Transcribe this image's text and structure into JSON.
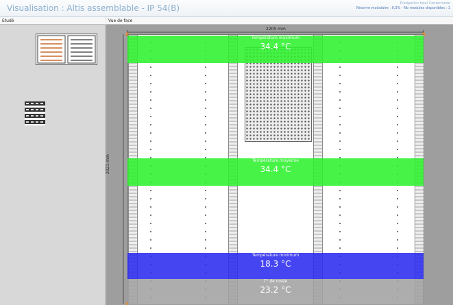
{
  "window": {
    "title": "Visualisation : Altis assemblable - IP 54(B)",
    "status_line1": "Dissipation total Consommée",
    "status_line2": "Réserve modulaire : 0,3% - Nb modules disponibles : 1"
  },
  "left_pane": {
    "header": "Etudé"
  },
  "right_pane": {
    "header": "Vue de face",
    "width_dimension": "2205 mm",
    "height_dimension": "2021 mm"
  },
  "bands": {
    "maximum": {
      "label": "Température maximum",
      "value": "34.4 °C",
      "color": "#2ef12e"
    },
    "moyenne": {
      "label": "Température moyenne",
      "value": "34.4 °C",
      "color": "#2ef12e"
    },
    "minimum": {
      "label": "Température minimum",
      "value": "18.3 °C",
      "color": "#2b2bf0"
    },
    "rosee": {
      "label": "T° de rosée",
      "value": "23.2 °C",
      "color": "#a2a2a2"
    }
  }
}
